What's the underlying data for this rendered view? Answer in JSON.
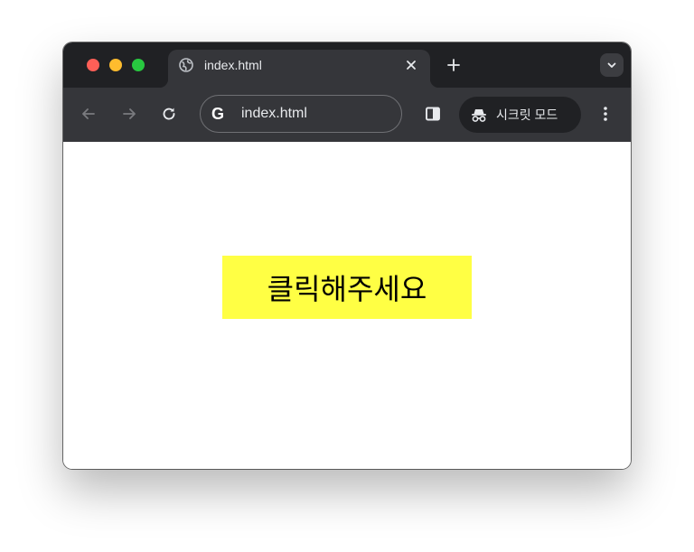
{
  "tab": {
    "title": "index.html",
    "close_symbol": "×",
    "favicon": "globe-icon"
  },
  "tabstrip": {
    "new_tab_symbol": "+",
    "tab_search_icon": "chevron-down-icon"
  },
  "toolbar": {
    "back_icon": "arrow-left-icon",
    "forward_icon": "arrow-right-icon",
    "reload_icon": "reload-icon",
    "address_logo": "G",
    "address_text": "index.html",
    "side_panel_icon": "side-panel-icon",
    "incognito_label": "시크릿 모드",
    "menu_icon": "kebab-menu-icon"
  },
  "page": {
    "button_text": "클릭해주세요"
  },
  "colors": {
    "button_bg": "#ffff44",
    "tab_strip": "#202124",
    "toolbar": "#35363a"
  }
}
